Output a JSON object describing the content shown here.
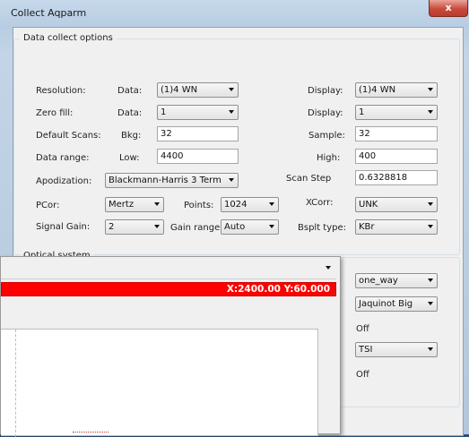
{
  "window": {
    "title": "Collect Aqparm",
    "close_glyph": "x"
  },
  "group": {
    "legend": "Data collect options"
  },
  "rows": {
    "resolution": {
      "label": "Resolution:",
      "data_label": "Data:",
      "data_value": "(1)4 WN",
      "display_label": "Display:",
      "display_value": "(1)4 WN"
    },
    "zero_fill": {
      "label": "Zero fill:",
      "data_label": "Data:",
      "data_value": "1",
      "display_label": "Display:",
      "display_value": "1"
    },
    "default_scans": {
      "label": "Default Scans:",
      "bkg_label": "Bkg:",
      "bkg_value": "32",
      "sample_label": "Sample:",
      "sample_value": "32"
    },
    "data_range": {
      "label": "Data range:",
      "low_label": "Low:",
      "low_value": "4400",
      "high_label": "High:",
      "high_value": "400"
    },
    "apodization": {
      "label": "Apodization:",
      "value": "Blackmann-Harris 3 Term",
      "scan_step_label": "Scan Step",
      "scan_step_value": "0.6328818"
    },
    "pcor": {
      "label": "PCor:",
      "value": "Mertz",
      "points_label": "Points:",
      "points_value": "1024",
      "xcorr_label": "XCorr:",
      "xcorr_value": "UNK"
    },
    "signal_gain": {
      "label": "Signal Gain:",
      "value": "2",
      "gain_range_label": "Gain range:",
      "gain_range_value": "Auto",
      "bsplt_label": "Bsplt type:",
      "bsplt_value": "KBr"
    }
  },
  "optical": {
    "legend_partial": "Optical system",
    "combo1": "one_way",
    "combo2": "Jaquinot Big",
    "text1": "Off",
    "combo3": "TSI",
    "text2": "Off"
  },
  "plot": {
    "coord_readout": "X:2400.00 Y:60.000",
    "grip": ".::"
  }
}
